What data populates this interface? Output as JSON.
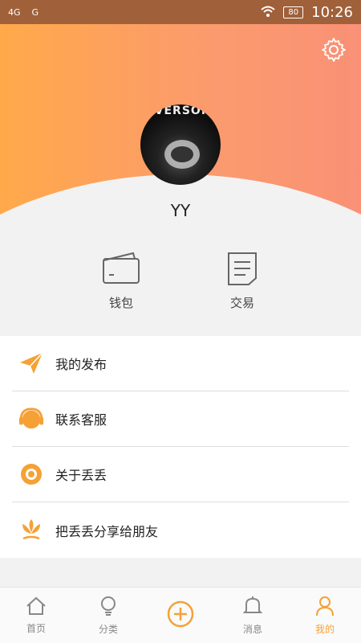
{
  "status": {
    "left_signal_1": "4G",
    "left_signal_2": "G",
    "battery": "80",
    "time": "10:26"
  },
  "profile": {
    "avatar_text": "IVERSON",
    "username": "YY"
  },
  "quick_actions": [
    {
      "label": "钱包",
      "icon": "wallet-icon"
    },
    {
      "label": "交易",
      "icon": "document-icon"
    }
  ],
  "menu": [
    {
      "label": "我的发布",
      "icon": "paper-plane-icon"
    },
    {
      "label": "联系客服",
      "icon": "headphones-icon"
    },
    {
      "label": "关于丢丢",
      "icon": "eye-icon"
    },
    {
      "label": "把丢丢分享给朋友",
      "icon": "flower-icon"
    }
  ],
  "tabs": [
    {
      "label": "首页",
      "icon": "home-icon"
    },
    {
      "label": "分类",
      "icon": "bulb-icon"
    },
    {
      "label": "",
      "icon": "add-icon"
    },
    {
      "label": "消息",
      "icon": "bell-icon"
    },
    {
      "label": "我的",
      "icon": "user-icon"
    }
  ],
  "colors": {
    "accent": "#f5a136",
    "header_start": "#ffa94a",
    "header_end": "#f99176"
  }
}
